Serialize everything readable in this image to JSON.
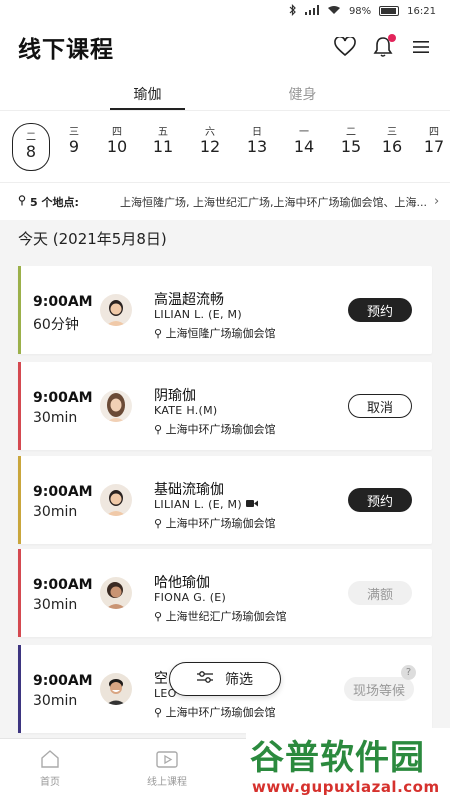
{
  "status_bar": {
    "battery": "98%",
    "time": "16:21"
  },
  "header": {
    "title": "线下课程"
  },
  "tabs": [
    {
      "label": "瑜伽",
      "active": true
    },
    {
      "label": "健身",
      "active": false
    }
  ],
  "dates": [
    {
      "weekday": "二",
      "day": "8",
      "selected": true
    },
    {
      "weekday": "三",
      "day": "9"
    },
    {
      "weekday": "四",
      "day": "10"
    },
    {
      "weekday": "五",
      "day": "11"
    },
    {
      "weekday": "六",
      "day": "12"
    },
    {
      "weekday": "日",
      "day": "13"
    },
    {
      "weekday": "一",
      "day": "14"
    },
    {
      "weekday": "二",
      "day": "15"
    },
    {
      "weekday": "三",
      "day": "16"
    },
    {
      "weekday": "四",
      "day": "17"
    }
  ],
  "locations": {
    "count_label": "5 个地点:",
    "list": "上海恒隆广场, 上海世纪汇广场,上海中环广场瑜伽会馆、上海..."
  },
  "today_label": "今天 (2021年5月8日)",
  "classes": [
    {
      "time": "9:00AM",
      "duration": "60分钟",
      "name": "高温超流畅",
      "teacher": "LILIAN L.  (E, M)",
      "location": "上海恒隆广场瑜伽会馆",
      "button": "预约",
      "button_style": "dark",
      "accent": "#9bb04a",
      "video": false
    },
    {
      "time": "9:00AM",
      "duration": "30min",
      "name": "阴瑜伽",
      "teacher": "KATE H.(M)",
      "location": "上海中环广场瑜伽会馆",
      "button": "取消",
      "button_style": "outline",
      "accent": "#d44950",
      "video": false
    },
    {
      "time": "9:00AM",
      "duration": "30min",
      "name": "基础流瑜伽",
      "teacher": "LILIAN L.  (E, M)",
      "location": "上海中环广场瑜伽会馆",
      "button": "预约",
      "button_style": "dark",
      "accent": "#c9a63c",
      "video": true
    },
    {
      "time": "9:00AM",
      "duration": "30min",
      "name": "哈他瑜伽",
      "teacher": "FIONA G. (E)",
      "location": "上海世纪汇广场瑜伽会馆",
      "button": "满额",
      "button_style": "gray",
      "accent": "#d44950",
      "video": false
    },
    {
      "time": "9:00AM",
      "duration": "30min",
      "name": "空",
      "teacher": "LEO",
      "location": "上海中环广场瑜伽会馆",
      "button": "现场等候",
      "button_style": "gray",
      "accent": "#3d3580",
      "video": false,
      "help": "?"
    }
  ],
  "filter_button": {
    "label": "筛选"
  },
  "bottom_nav": [
    {
      "label": "首页"
    },
    {
      "label": "线上课程"
    }
  ],
  "watermark": {
    "text": "谷普软件园",
    "url": "www.gupuxlazal.com"
  },
  "colors": {
    "accent_red": "#e2245a",
    "dark": "#222222"
  }
}
